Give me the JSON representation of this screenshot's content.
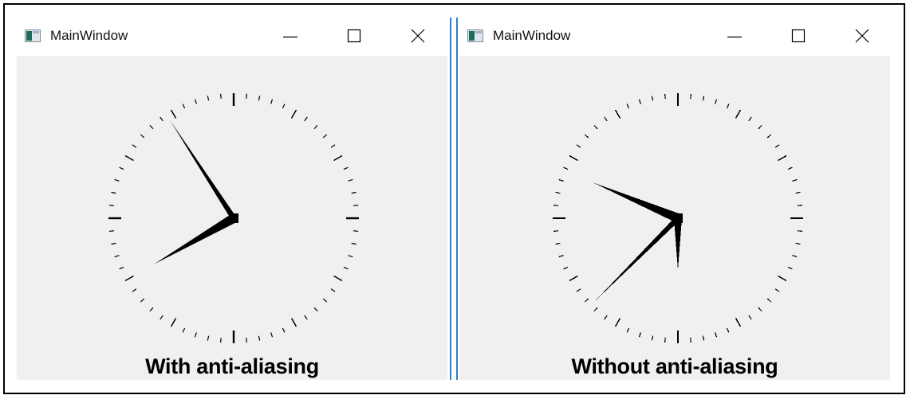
{
  "windows": [
    {
      "title": "MainWindow",
      "caption": "With anti-aliasing",
      "controls": {
        "minimize": "minimize",
        "maximize": "maximize",
        "close": "close"
      },
      "clock": {
        "hour": 7.95,
        "minute": 40,
        "second": 54.5,
        "antialiased": true
      }
    },
    {
      "title": "MainWindow",
      "caption": "Without anti-aliasing",
      "controls": {
        "minimize": "minimize",
        "maximize": "maximize",
        "close": "close"
      },
      "clock": {
        "hour": 6,
        "minute": 48.8,
        "second": 37.5,
        "antialiased": false
      }
    }
  ],
  "colors": {
    "client_background": "#f0f0f0",
    "divider": "#2b7fd0",
    "ink": "#000000"
  },
  "icons": [
    "app-window-icon",
    "minimize-icon",
    "maximize-icon",
    "close-icon"
  ]
}
